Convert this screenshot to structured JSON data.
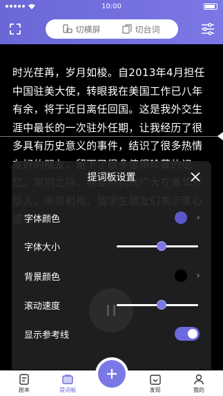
{
  "status_bar": {
    "time": "10:00"
  },
  "header": {
    "toggle_horizontal_label": "切横屏",
    "toggle_script_label": "切台词"
  },
  "script": {
    "text": "时光荏苒，岁月如梭。自2013年4月担任中国驻美大使，转眼我在美国工作已八年有余，将于近日离任回国。这是我外交生涯中最长的一次驻外任期，让我经历了很多具有历史意义的事件，结识了很多热情友好的朋友，留下了很多值得珍藏的记忆。离别之际，我要特别向广大在美华侨华人，中资机构、留学生朋友们表示衷心感谢。"
  },
  "settings_panel": {
    "title": "提词板设置",
    "font_color_label": "字体颜色",
    "font_size_label": "字体大小",
    "bg_color_label": "背景颜色",
    "scroll_speed_label": "滚动速度",
    "show_guide_label": "显示参考线",
    "font_color": "#5a57c8",
    "bg_color": "#000000",
    "font_size_level": 0.55,
    "scroll_speed_level": 0.55,
    "show_guide": true
  },
  "tabbar": {
    "tabs": [
      {
        "label": "剧本"
      },
      {
        "label": "提词板"
      },
      {
        "label": "发现"
      },
      {
        "label": "我的"
      }
    ],
    "active_index": 1
  },
  "colors": {
    "accent": "#7b78e6",
    "header": "#6a67d6"
  }
}
